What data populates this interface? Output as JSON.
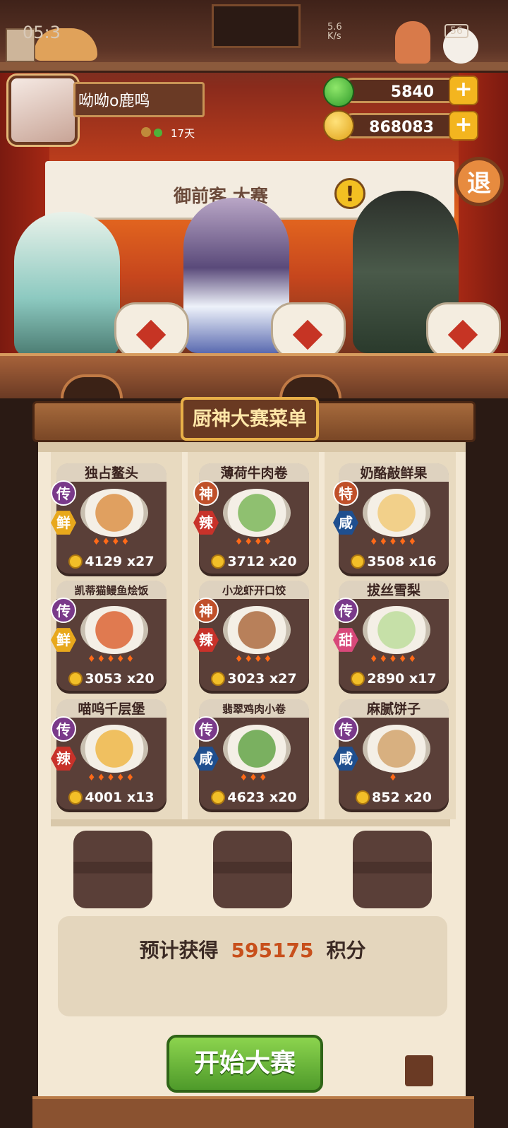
{
  "status_bar": {
    "time": "05:3",
    "net_speed": "5.6 K/s",
    "battery": "56"
  },
  "player": {
    "name": "呦呦o鹿鸣",
    "days": "17天"
  },
  "currencies": [
    {
      "name": "jade",
      "value": "5840",
      "icon": "jade-icon",
      "color": "#3fb03a"
    },
    {
      "name": "coin",
      "value": "868083",
      "icon": "coin-icon",
      "color": "#f2bf28"
    }
  ],
  "header": {
    "exit_label": "退",
    "contest_name": "御前客 大赛",
    "alert_label": "!"
  },
  "menu": {
    "title": "厨神大赛菜单",
    "dishes": [
      {
        "name": "独占鳌头",
        "rarity": "传",
        "flavor": "鲜",
        "flames": 4,
        "price": "4129",
        "qty": "x27"
      },
      {
        "name": "薄荷牛肉卷",
        "rarity": "神",
        "flavor": "辣",
        "flames": 4,
        "price": "3712",
        "qty": "x20"
      },
      {
        "name": "奶酪敲鲜果",
        "rarity": "特",
        "flavor": "咸",
        "flames": 5,
        "price": "3508",
        "qty": "x16"
      },
      {
        "name": "凯蒂猫鳗鱼烩饭",
        "rarity": "传",
        "flavor": "鲜",
        "flames": 5,
        "price": "3053",
        "qty": "x20"
      },
      {
        "name": "小龙虾开口饺",
        "rarity": "神",
        "flavor": "辣",
        "flames": 4,
        "price": "3023",
        "qty": "x27"
      },
      {
        "name": "拔丝雪梨",
        "rarity": "传",
        "flavor": "甜",
        "flames": 5,
        "price": "2890",
        "qty": "x17"
      },
      {
        "name": "喵呜千层堡",
        "rarity": "传",
        "flavor": "辣",
        "flames": 5,
        "price": "4001",
        "qty": "x13"
      },
      {
        "name": "翡翠鸡肉小卷",
        "rarity": "传",
        "flavor": "咸",
        "flames": 3,
        "price": "4623",
        "qty": "x20"
      },
      {
        "name": "麻腻饼子",
        "rarity": "传",
        "flavor": "咸",
        "flames": 1,
        "price": "852",
        "qty": "x20"
      }
    ]
  },
  "colors": {
    "rarity_legend": "#7a3a8a",
    "rarity_god": "#c0502a",
    "rarity_special": "#c0502a",
    "flavor_fresh": "#e8a81c",
    "flavor_spicy": "#c8322a",
    "flavor_salty": "#1f4f8f",
    "flavor_sweet": "#d8497a",
    "flame": "#ff6a18"
  },
  "score": {
    "label": "预计获得",
    "value": "595175",
    "unit": "积分"
  },
  "start_button": "开始大赛"
}
